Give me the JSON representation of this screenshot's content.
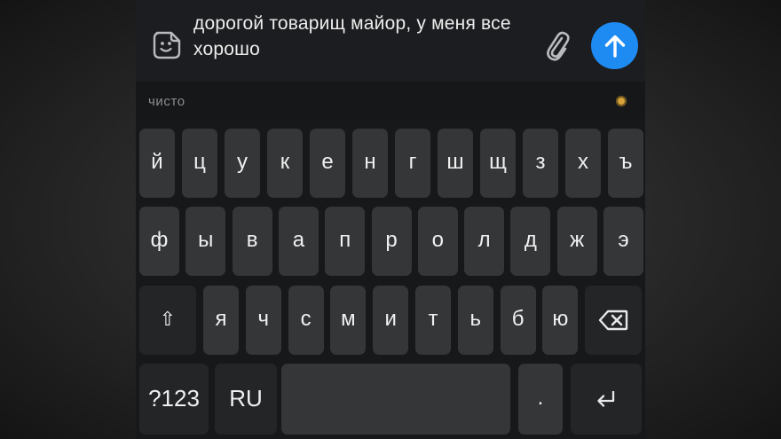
{
  "compose": {
    "message_text": "дорогой товарищ майор, у меня все хорошо",
    "sticker_icon": "sticker-icon",
    "attach_icon": "paperclip-icon",
    "send_icon": "arrow-up-icon"
  },
  "suggestions": {
    "word": "чисто",
    "mic_indicator": "voice-indicator-dot"
  },
  "keyboard": {
    "row1": [
      "й",
      "ц",
      "у",
      "к",
      "е",
      "н",
      "г",
      "ш",
      "щ",
      "з",
      "х",
      "ъ"
    ],
    "row2": [
      "ф",
      "ы",
      "в",
      "а",
      "п",
      "р",
      "о",
      "л",
      "д",
      "ж",
      "э"
    ],
    "row3": [
      "я",
      "ч",
      "с",
      "м",
      "и",
      "т",
      "ь",
      "б",
      "ю"
    ],
    "shift_label": "⇧",
    "symbols_label": "?123",
    "language_label": "RU",
    "space_label": "",
    "period_label": "."
  },
  "colors": {
    "send_button": "#1e8bf3",
    "key_bg": "#353638",
    "function_key_bg": "#242527",
    "mic_dot": "#d8a33a"
  }
}
